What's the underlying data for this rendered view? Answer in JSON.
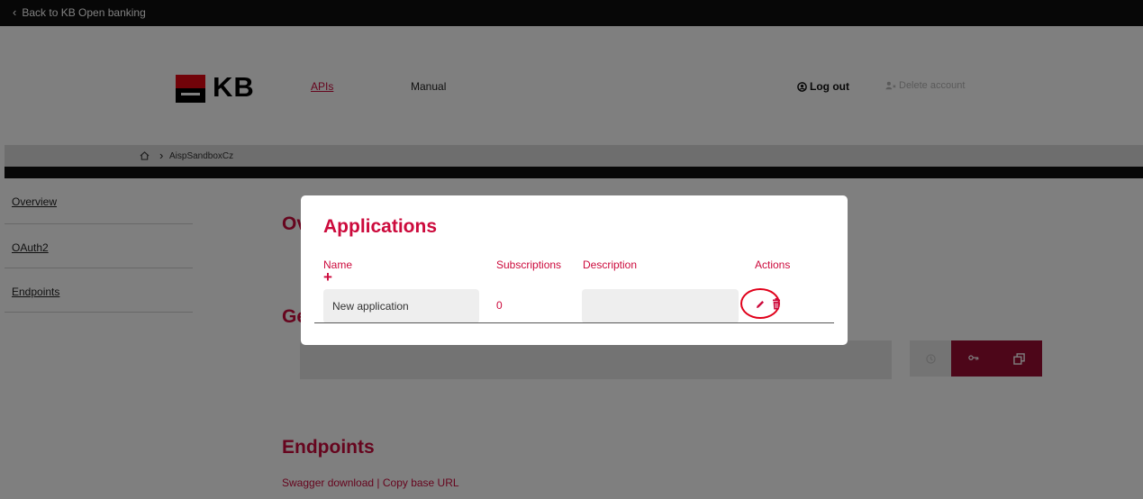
{
  "topbar": {
    "back_label": "Back to KB Open banking"
  },
  "header": {
    "logo_text": "KB",
    "nav": {
      "apis": "APIs",
      "manual": "Manual"
    },
    "logout": "Log out",
    "delete_account": "Delete account"
  },
  "breadcrumb": {
    "current": "AispSandboxCz"
  },
  "sidebar": {
    "items": [
      {
        "label": "Overview"
      },
      {
        "label": "OAuth2"
      },
      {
        "label": "Endpoints"
      }
    ]
  },
  "main": {
    "overview_title_partial": "Ov",
    "generate_title_partial": "Ge",
    "endpoints_title": "Endpoints",
    "swagger_links": "Swagger download | Copy base URL"
  },
  "modal": {
    "title": "Applications",
    "columns": {
      "name": "Name",
      "subscriptions": "Subscriptions",
      "description": "Description",
      "actions": "Actions"
    },
    "add_icon": "plus-icon",
    "rows": [
      {
        "name": "New application",
        "subscriptions": "0",
        "description": ""
      }
    ]
  },
  "colors": {
    "brand_red": "#cc0a3c",
    "logo_red": "#e30613",
    "button_dark_red": "#9a0c32",
    "highlight_red": "#e0001a"
  },
  "icons": [
    "chevron-left-icon",
    "home-icon",
    "chevron-right-icon",
    "user-circle-icon",
    "user-delete-icon",
    "clock-icon",
    "key-icon",
    "copy-icon",
    "pencil-icon",
    "trash-icon"
  ]
}
